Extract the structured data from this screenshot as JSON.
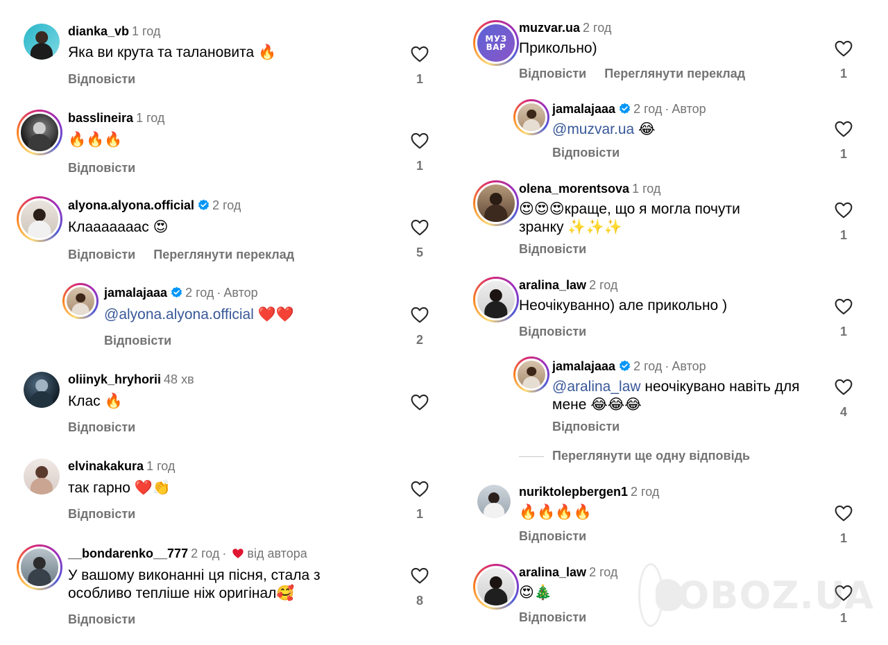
{
  "ui": {
    "reply_label": "Відповісти",
    "translate_label": "Переглянути переклад",
    "author_label": "Автор",
    "from_author_label": "від автора",
    "dot": "·",
    "more_replies_label": "Переглянути ще одну відповідь",
    "watermark": "OBOZ.UA",
    "accent_color": "#385898",
    "verified_color": "#0095f6"
  },
  "left": [
    {
      "user": "dianka_vb",
      "time": "1 год",
      "text": "Яка ви крута та талановита 🔥",
      "likes": "1"
    },
    {
      "user": "basslineira",
      "time": "1 год",
      "text": "🔥🔥🔥",
      "likes": "1"
    },
    {
      "user": "alyona.alyona.official",
      "time": "2 год",
      "text": "Клааааааас 😍",
      "likes": "5"
    },
    {
      "user": "jamalajaaa",
      "time": "2 год",
      "mention": "@alyona.alyona.official",
      "text": " ❤️❤️",
      "likes": "2"
    },
    {
      "user": "oliinyk_hryhorii",
      "time": "48 хв",
      "text": "Клас 🔥",
      "likes": ""
    },
    {
      "user": "elvinakakura",
      "time": "1 год",
      "text": "так гарно ❤️👏",
      "likes": "1"
    },
    {
      "user": "__bondarenko__777",
      "time": "2 год",
      "text_line1": "У вашому виконанні ця пісня, стала з",
      "text_line2": "особливо тепліше ніж оригінал🥰",
      "likes": "8"
    }
  ],
  "right": [
    {
      "user": "muzvar.ua",
      "time": "2 год",
      "text": "Прикольно)",
      "likes": "1",
      "avatar_text_1": "МУЗ",
      "avatar_text_2": "ВАР"
    },
    {
      "user": "jamalajaaa",
      "time": "2 год",
      "mention": "@muzvar.ua",
      "text": " 😂",
      "likes": "1"
    },
    {
      "user": "olena_morentsova",
      "time": "1 год",
      "text_line1": "😍😍😍краще, що я могла почути",
      "text_line2": "зранку ✨✨✨",
      "likes": "1"
    },
    {
      "user": "aralina_law",
      "time": "2 год",
      "text": "Неочікуванно) але прикольно )",
      "likes": "1"
    },
    {
      "user": "jamalajaaa",
      "time": "2 год",
      "mention": "@aralina_law",
      "text": " неочікувано навіть для",
      "text_line2": "мене 😂😂😂",
      "likes": "4"
    },
    {
      "user": "nuriktolepbergen1",
      "time": "2 год",
      "text": "🔥🔥🔥🔥",
      "likes": "1"
    },
    {
      "user": "aralina_law",
      "time": "2 год",
      "text": "😍🎄",
      "likes": "1"
    }
  ]
}
